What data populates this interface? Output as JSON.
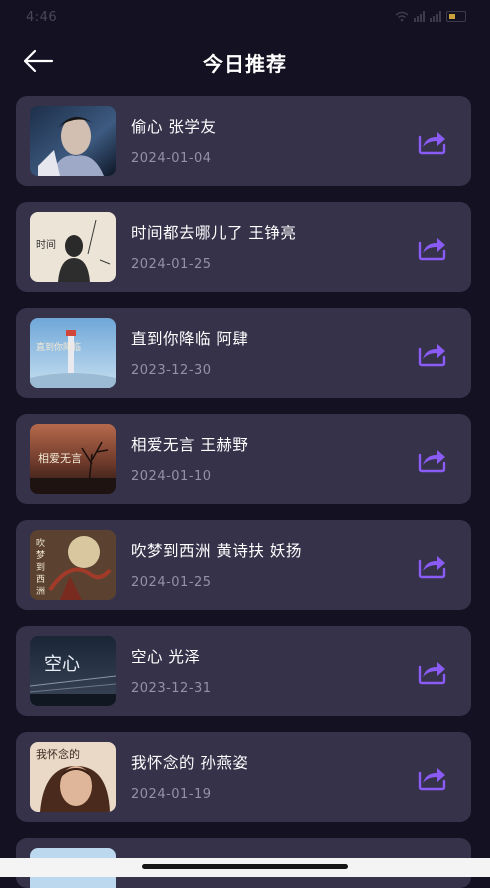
{
  "status_bar": {
    "time": "4:46",
    "icons": [
      "wifi-icon",
      "signal-icon",
      "battery-icon"
    ]
  },
  "header": {
    "title": "今日推荐",
    "back_icon": "arrow-left-icon"
  },
  "songs": [
    {
      "title": "偷心 张学友",
      "date": "2024-01-04"
    },
    {
      "title": "时间都去哪儿了 王铮亮",
      "date": "2024-01-25",
      "cover_text": "时间"
    },
    {
      "title": "直到你降临 阿肆",
      "date": "2023-12-30",
      "cover_text": "直到你降临"
    },
    {
      "title": "相爱无言 王赫野",
      "date": "2024-01-10",
      "cover_text": "相爱无言"
    },
    {
      "title": "吹梦到西洲 黄诗扶 妖扬",
      "date": "2024-01-25",
      "cover_text": "吹梦到西洲"
    },
    {
      "title": "空心 光泽",
      "date": "2023-12-31",
      "cover_text": "空心"
    },
    {
      "title": "我怀念的 孙燕姿",
      "date": "2024-01-19",
      "cover_text": "我怀念的"
    }
  ],
  "share_icon": "share-icon",
  "colors": {
    "background": "#141222",
    "card": "#35324a",
    "accent": "#8a5cf5",
    "date_text": "#9592a6"
  }
}
